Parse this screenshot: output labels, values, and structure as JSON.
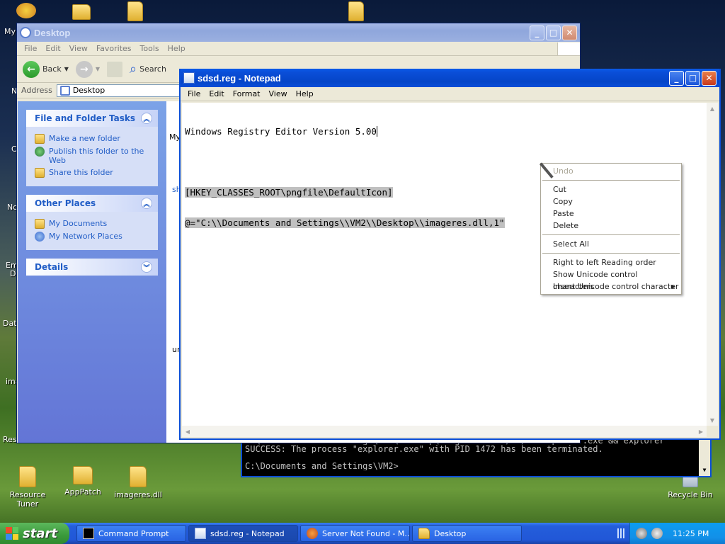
{
  "desktop": {
    "edge_labels": [
      "My",
      "N",
      "C",
      "No",
      "Em",
      "D",
      "Data",
      "ima",
      "Res"
    ],
    "bottom_icons": [
      {
        "label": "Resource Tuner",
        "icon": "resource-tuner-icon"
      },
      {
        "label": "AppPatch",
        "icon": "folder-icon"
      },
      {
        "label": "imageres.dll",
        "icon": "folder-icon"
      }
    ],
    "recycle_bin": "Recycle Bin"
  },
  "explorer": {
    "title": "Desktop",
    "menu": [
      "File",
      "Edit",
      "View",
      "Favorites",
      "Tools",
      "Help"
    ],
    "toolbar": {
      "back": "Back",
      "search": "Search"
    },
    "address_label": "Address",
    "address_value": "Desktop",
    "tasks": {
      "file_folder": {
        "title": "File and Folder Tasks",
        "items": [
          "Make a new folder",
          "Publish this folder to the Web",
          "Share this folder"
        ]
      },
      "other_places": {
        "title": "Other Places",
        "items": [
          "My Documents",
          "My Network Places"
        ]
      },
      "details": {
        "title": "Details"
      }
    },
    "content_fragments": [
      "My",
      "sh",
      "un"
    ]
  },
  "notepad": {
    "title": "sdsd.reg - Notepad",
    "menu": [
      "File",
      "Edit",
      "Format",
      "View",
      "Help"
    ],
    "lines": [
      "Windows Registry Editor Version 5.00",
      "",
      "[HKEY_CLASSES_ROOT\\pngfile\\DefaultIcon]",
      "@=\"C:\\\\Documents and Settings\\\\VM2\\\\Desktop\\\\imageres.dll,1\""
    ]
  },
  "context_menu": {
    "items": [
      {
        "label": "Undo",
        "disabled": true
      },
      {
        "sep": true
      },
      {
        "label": "Cut"
      },
      {
        "label": "Copy"
      },
      {
        "label": "Paste"
      },
      {
        "label": "Delete"
      },
      {
        "sep": true
      },
      {
        "label": "Select All"
      },
      {
        "sep": true
      },
      {
        "label": "Right to left Reading order"
      },
      {
        "label": "Show Unicode control characters"
      },
      {
        "label": "Insert Unicode control character",
        "submenu": true
      }
    ]
  },
  "console": {
    "lines": [
      "C:\\Documents and Settings\\VM2\\Desktop\\imageres.dll /f /im explorer.exe && explorer",
      "SUCCESS: The process \"explorer.exe\" with PID 1472 has been terminated.",
      "",
      "C:\\Documents and Settings\\VM2>"
    ]
  },
  "taskbar": {
    "start": "start",
    "tasks": [
      {
        "label": "Command Prompt",
        "icon": "cmd-icon",
        "active": false
      },
      {
        "label": "sdsd.reg - Notepad",
        "icon": "notepad-icon",
        "active": true
      },
      {
        "label": "Server Not Found - M...",
        "icon": "browser-icon",
        "active": false
      },
      {
        "label": "Desktop",
        "icon": "folder-icon",
        "active": false
      }
    ],
    "clock": "11:25 PM"
  },
  "colors": {
    "xp_blue": "#0a4ed8",
    "task_link": "#215dc6",
    "start_green": "#3a9a3a"
  }
}
